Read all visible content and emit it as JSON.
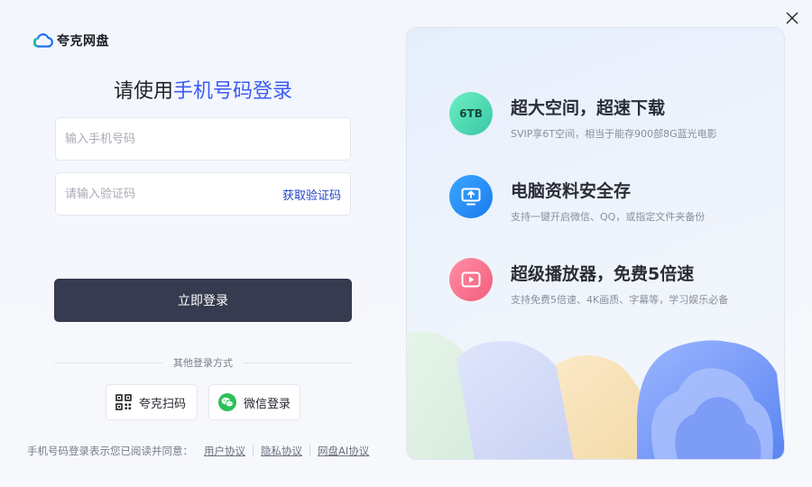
{
  "brand": {
    "name": "夸克网盘",
    "icon": "cloud-icon"
  },
  "window": {
    "close_icon": "close-icon"
  },
  "login": {
    "title_prefix": "请使用",
    "title_highlight": "手机号码登录",
    "phone_placeholder": "输入手机号码",
    "phone_value": "",
    "code_placeholder": "请输入验证码",
    "code_value": "",
    "get_code_label": "获取验证码",
    "submit_label": "立即登录",
    "other_methods_label": "其他登录方式",
    "methods": [
      {
        "label": "夸克扫码",
        "icon": "qr-code-icon"
      },
      {
        "label": "微信登录",
        "icon": "wechat-icon"
      }
    ],
    "agreement_text": "手机号码登录表示您已阅读并同意：",
    "links": [
      "用户协议",
      "隐私协议",
      "网盘AI协议"
    ]
  },
  "promo": {
    "features": [
      {
        "badge": "6TB",
        "title": "超大空间，超速下载",
        "subtitle": "SVIP享6T空间，相当于能存900部8G蓝光电影"
      },
      {
        "icon": "monitor-upload-icon",
        "title": "电脑资料安全存",
        "subtitle": "支持一键开启微信、QQ，或指定文件夹备份"
      },
      {
        "icon": "play-icon",
        "title": "超级播放器，免费5倍速",
        "subtitle": "支持免费5倍速、4K画质、字幕等，学习娱乐必备"
      }
    ]
  },
  "colors": {
    "accent": "#3b5bf5",
    "button_dark": "#373b4f",
    "link": "#2344c8",
    "wechat_green": "#2bc15a"
  }
}
